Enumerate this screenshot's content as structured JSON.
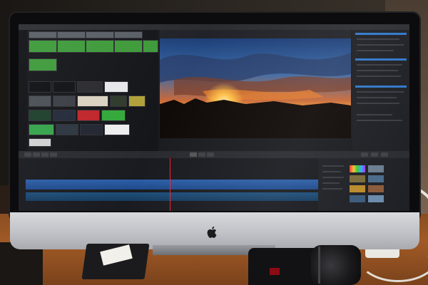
{
  "scene": {
    "description_kind": "photo of an all-in-one computer running a video editing application on a wooden desk",
    "colors": {
      "desk": "#a15a26",
      "bezel": "#0c0c0e",
      "chin": "#c8c9cd",
      "app_dark": "#1b1c20",
      "accent_blue": "#2f77c8",
      "clip_green": "#3e9a3a",
      "clip_red": "#c0262b",
      "sunset_orange": "#f08a24",
      "sky_blue": "#3a6aa8"
    }
  },
  "icons": {
    "apple": "apple-logo-icon",
    "play": "play-icon"
  },
  "app": {
    "window_title": "",
    "viewer_label": ""
  }
}
